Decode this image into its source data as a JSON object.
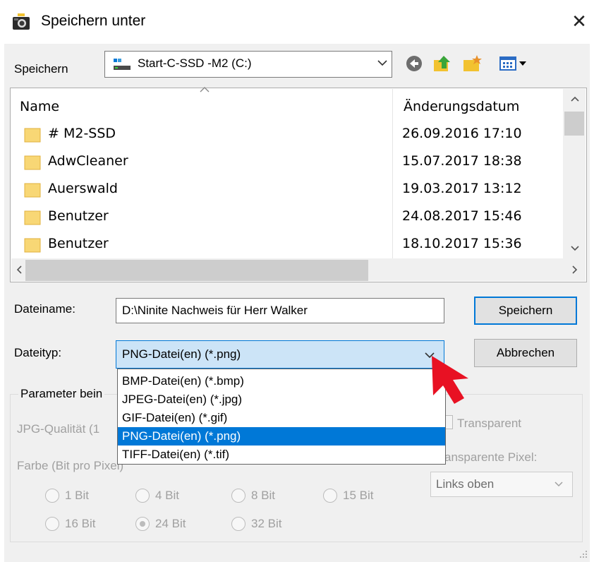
{
  "window": {
    "title": "Speichern unter",
    "icon": "camera-icon",
    "close_symbol": "✕"
  },
  "save_in": {
    "label": "Speichern",
    "value": "Start-C-SSD -M2 (C:)",
    "icon": "drive-icon"
  },
  "toolbar": {
    "buttons": [
      "back-icon",
      "up-folder-icon",
      "new-folder-icon",
      "view-menu-icon"
    ]
  },
  "file_list": {
    "columns": [
      "Name",
      "Änderungsdatum"
    ],
    "rows": [
      {
        "name": "# M2-SSD",
        "date": "26.09.2016 17:10"
      },
      {
        "name": "AdwCleaner",
        "date": "15.07.2017 18:38"
      },
      {
        "name": "Auerswald",
        "date": "19.03.2017 13:12"
      },
      {
        "name": "Benutzer",
        "date": "24.08.2017 15:46"
      },
      {
        "name": "Benutzer",
        "date": "18.10.2017 15:36"
      }
    ]
  },
  "filename": {
    "label": "Dateiname:",
    "value": "D:\\Ninite Nachweis für Herr Walker"
  },
  "filetype": {
    "label": "Dateityp:",
    "value": "PNG-Datei(en) (*.png)",
    "options": [
      "BMP-Datei(en) (*.bmp)",
      "JPEG-Datei(en) (*.jpg)",
      "GIF-Datei(en) (*.gif)",
      "PNG-Datei(en) (*.png)",
      "TIFF-Datei(en) (*.tif)"
    ],
    "selected_index": 3
  },
  "buttons": {
    "save": "Speichern",
    "cancel": "Abbrechen"
  },
  "params": {
    "title": "Parameter bein",
    "jpg_quality_label": "JPG-Qualität (1",
    "transparent_label": "Transparent",
    "color_label": "Farbe (Bit pro Pixel)",
    "transparent_pixel_label": "ansparente Pixel:",
    "corner_value": "Links oben",
    "bits": [
      {
        "label": "1 Bit",
        "checked": false
      },
      {
        "label": "4 Bit",
        "checked": false
      },
      {
        "label": "8 Bit",
        "checked": false
      },
      {
        "label": "15 Bit",
        "checked": false
      },
      {
        "label": "16 Bit",
        "checked": false
      },
      {
        "label": "24 Bit",
        "checked": true
      },
      {
        "label": "32 Bit",
        "checked": false
      }
    ]
  },
  "colors": {
    "accent": "#0078d7",
    "selection_bg": "#cce4f7",
    "pointer": "#e81123",
    "folder": "#f8d775"
  }
}
